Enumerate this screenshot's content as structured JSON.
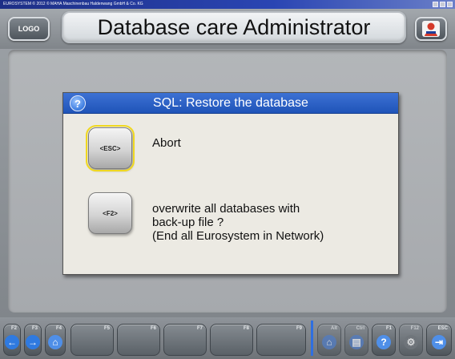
{
  "sysbar": {
    "text": "EUROSYSTEM  ©  2012  ©  MAHA Maschinenbau Haldenwang GmbH & Co. KG"
  },
  "header": {
    "logo_label": "LOGO",
    "title": "Database care Administrator"
  },
  "dialog": {
    "title": "SQL: Restore the database",
    "options": [
      {
        "key": "<ESC>",
        "lines": [
          "Abort"
        ]
      },
      {
        "key": "<F2>",
        "lines": [
          "overwrite all databases with",
          "back-up file ?",
          "(End all Eurosystem in Network)"
        ]
      }
    ]
  },
  "toolbar": {
    "buttons": [
      {
        "fkey": "F2",
        "icon": "arrow-left-icon",
        "glyph": "←"
      },
      {
        "fkey": "F3",
        "icon": "arrow-right-icon",
        "glyph": "→"
      },
      {
        "fkey": "F4",
        "icon": "home-icon",
        "glyph": "⌂"
      },
      {
        "fkey": "F5",
        "icon": "",
        "glyph": ""
      },
      {
        "fkey": "F6",
        "icon": "",
        "glyph": ""
      },
      {
        "fkey": "F7",
        "icon": "",
        "glyph": ""
      },
      {
        "fkey": "F8",
        "icon": "",
        "glyph": ""
      },
      {
        "fkey": "F9",
        "icon": "",
        "glyph": ""
      },
      {
        "fkey": "Alt",
        "icon": "home-icon",
        "glyph": "⌂"
      },
      {
        "fkey": "Ctrl",
        "icon": "printer-icon",
        "glyph": "▤"
      },
      {
        "fkey": "F1",
        "icon": "help-icon",
        "glyph": "?"
      },
      {
        "fkey": "F12",
        "icon": "settings-icon",
        "glyph": "⚙"
      },
      {
        "fkey": "ESC",
        "icon": "exit-icon",
        "glyph": "⇥"
      }
    ]
  }
}
